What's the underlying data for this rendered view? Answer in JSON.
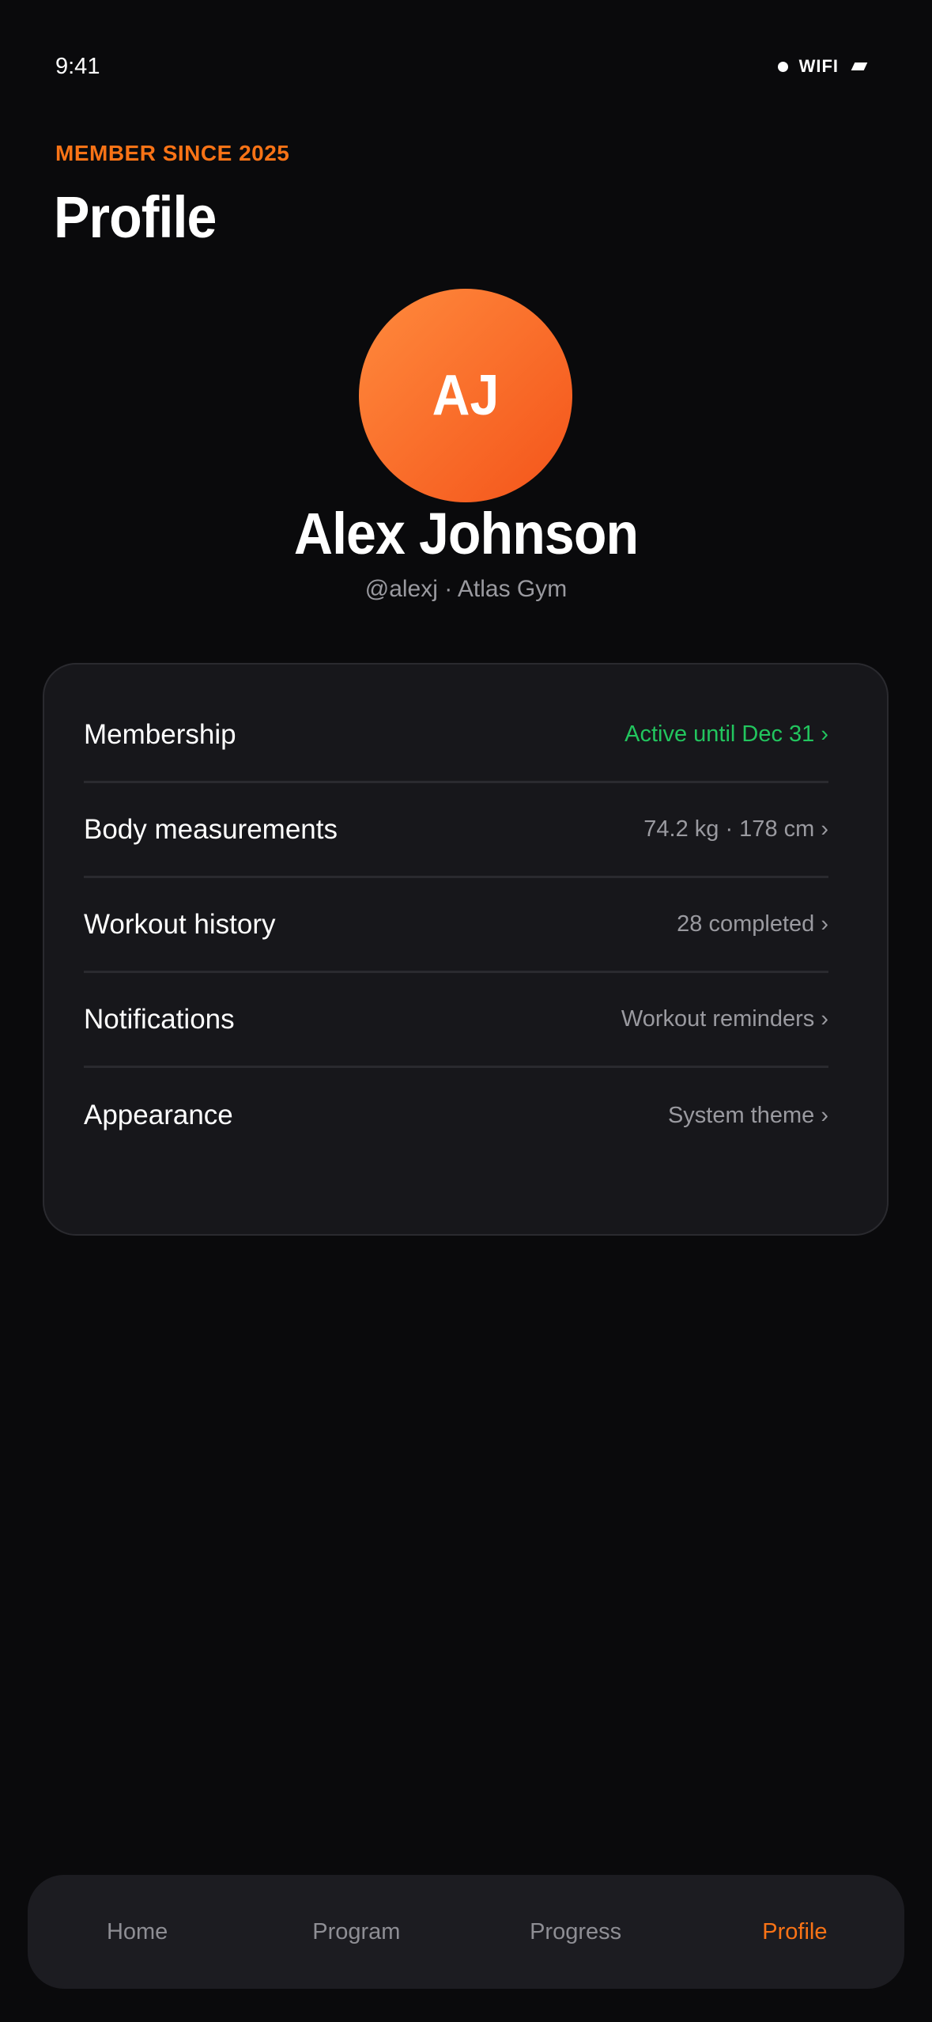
{
  "status_bar": {
    "time": "9:41",
    "wifi_label": "WIFI"
  },
  "header": {
    "eyebrow": "MEMBER SINCE 2025",
    "title": "Profile"
  },
  "profile": {
    "initials": "AJ",
    "name": "Alex Johnson",
    "subtitle": "@alexj · Atlas Gym"
  },
  "settings": [
    {
      "label": "Membership",
      "value": "Active until Dec 31 ›"
    },
    {
      "label": "Body measurements",
      "value": "74.2 kg · 178 cm ›"
    },
    {
      "label": "Workout history",
      "value": "28 completed ›"
    },
    {
      "label": "Notifications",
      "value": "Workout reminders ›"
    },
    {
      "label": "Appearance",
      "value": "System theme ›"
    }
  ],
  "nav": {
    "items": [
      "Home",
      "Program",
      "Progress",
      "Profile"
    ],
    "active": "Profile"
  },
  "colors": {
    "accent": "#f97316",
    "success": "#22c55e",
    "background": "#0a0a0c",
    "card": "#17171b"
  }
}
